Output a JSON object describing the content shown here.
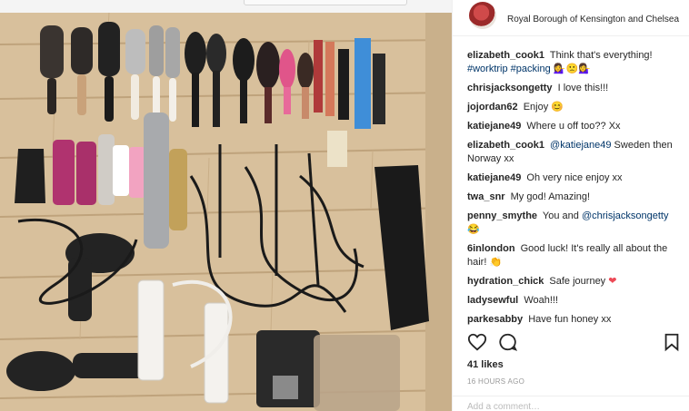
{
  "post": {
    "location": "Royal Borough of Kensington and Chelsea",
    "likes": "41 likes",
    "timestamp": "16 HOURS AGO",
    "add_comment_placeholder": "Add a comment…"
  },
  "icons": {
    "like": "heart-outline-icon",
    "comment": "comment-bubble-icon",
    "save": "bookmark-icon"
  },
  "colors": {
    "link": "#003569",
    "heart": "#ed4956",
    "muted": "#999999"
  },
  "comments": [
    {
      "user": "elizabeth_cook1",
      "text": "Think that's everything!",
      "tags": "#worktrip #packing",
      "emoji": "💁‍♀️🙁💁‍♀️"
    },
    {
      "user": "chrisjacksongetty",
      "text": "I love this!!!"
    },
    {
      "user": "jojordan62",
      "text": "Enjoy",
      "emoji": "😊"
    },
    {
      "user": "katiejane49",
      "text": "Where u off too?? Xx"
    },
    {
      "user": "elizabeth_cook1",
      "mention": "@katiejane49",
      "text": "Sweden then Norway xx"
    },
    {
      "user": "katiejane49",
      "text": "Oh very nice enjoy xx"
    },
    {
      "user": "twa_snr",
      "text": "My god! Amazing!"
    },
    {
      "user": "penny_smythe",
      "text": "You and",
      "mention": "@chrisjacksongetty",
      "emoji": "😂"
    },
    {
      "user": "6inlondon",
      "text": "Good luck! It's really all about the hair!",
      "emoji": "👏"
    },
    {
      "user": "hydration_chick",
      "text": "Safe journey",
      "emoji": "❤"
    },
    {
      "user": "ladysewful",
      "text": "Woah!!!"
    },
    {
      "user": "parkesabby",
      "text": "Have fun honey xx"
    }
  ]
}
